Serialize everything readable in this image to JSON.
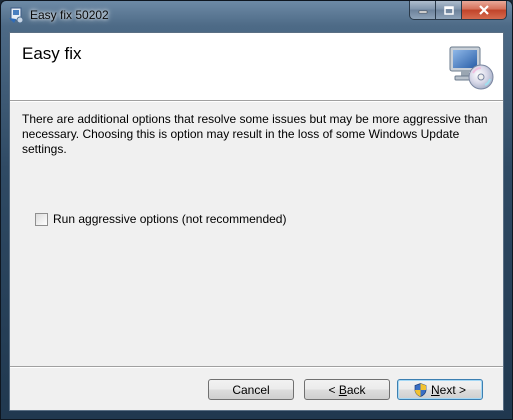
{
  "window": {
    "title": "Easy fix 50202",
    "controls": {
      "minimize": "minimize",
      "maximize": "maximize",
      "close": "close"
    }
  },
  "header": {
    "title": "Easy fix",
    "icon": "computer-disc-icon"
  },
  "body": {
    "description": "There are additional options that resolve some issues but may be more aggressive than necessary. Choosing this is option may result in the loss of some Windows Update settings.",
    "option": {
      "label": "Run aggressive options (not recommended)",
      "checked": false
    }
  },
  "footer": {
    "cancel_label": "Cancel",
    "back_prefix": "< ",
    "back_accel": "B",
    "back_rest": "ack",
    "next_accel": "N",
    "next_rest": "ext",
    "next_suffix": " >"
  },
  "colors": {
    "client_bg": "#f0f0f0",
    "header_bg": "#ffffff",
    "default_button_border": "#3c7fb1"
  }
}
